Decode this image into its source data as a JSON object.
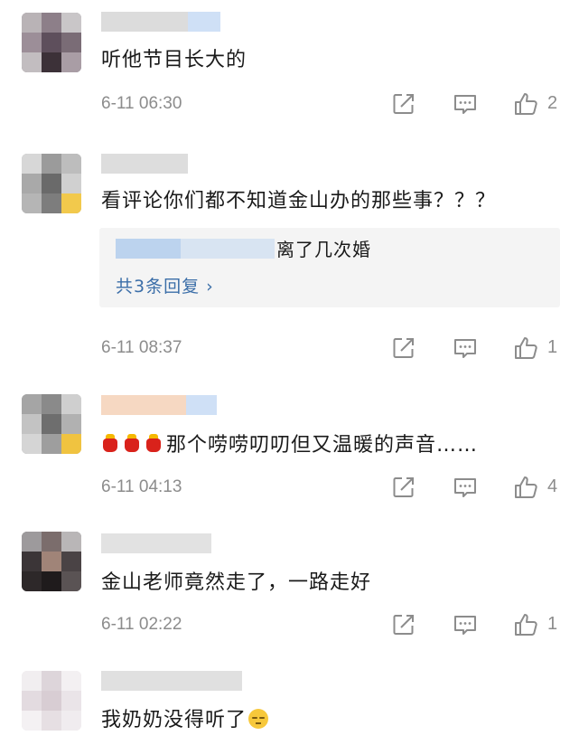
{
  "comments": [
    {
      "text": "听他节目长大的",
      "time": "6-11 06:30",
      "likes": "2",
      "reply": null
    },
    {
      "text": "看评论你们都不知道金山办的那些事？？？",
      "time": "6-11 08:37",
      "likes": "1",
      "reply": {
        "text": "离了几次婚",
        "more": "共3条回复 ›"
      }
    },
    {
      "text": "那个唠唠叨叨但又温暖的声音……",
      "emoji_prefix": [
        "fortune-bag-emoji",
        "fortune-bag-emoji",
        "fortune-bag-emoji"
      ],
      "time": "6-11 04:13",
      "likes": "4",
      "reply": null
    },
    {
      "text": "金山老师竟然走了，一路走好",
      "time": "6-11 02:22",
      "likes": "1",
      "reply": null
    },
    {
      "text": "我奶奶没得听了",
      "emoji_suffix": "speechless-face-emoji",
      "time": "",
      "likes": "",
      "reply": null
    }
  ],
  "icons": {
    "share": "share-icon",
    "comment": "comment-icon",
    "like": "thumbs-up-icon"
  },
  "colors": {
    "meta_text": "#8c8c8c",
    "link": "#3b6ea8",
    "reply_bg": "#f4f4f4"
  }
}
